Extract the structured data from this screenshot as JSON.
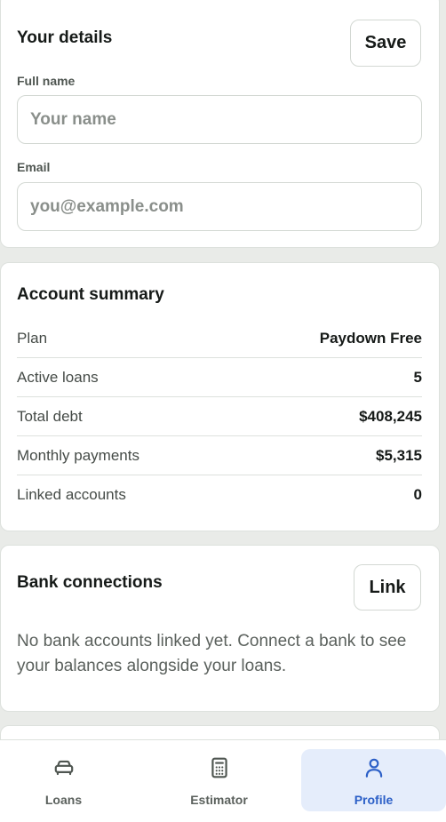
{
  "details": {
    "title": "Your details",
    "save_label": "Save",
    "full_name_label": "Full name",
    "full_name_placeholder": "Your name",
    "full_name_value": "",
    "email_label": "Email",
    "email_placeholder": "you@example.com",
    "email_value": ""
  },
  "summary": {
    "title": "Account summary",
    "rows": [
      {
        "label": "Plan",
        "value": "Paydown Free"
      },
      {
        "label": "Active loans",
        "value": "5"
      },
      {
        "label": "Total debt",
        "value": "$408,245"
      },
      {
        "label": "Monthly payments",
        "value": "$5,315"
      },
      {
        "label": "Linked accounts",
        "value": "0"
      }
    ]
  },
  "bank": {
    "title": "Bank connections",
    "link_label": "Link",
    "empty_text": "No bank accounts linked yet. Connect a bank to see your balances alongside your loans."
  },
  "nav": {
    "items": [
      {
        "label": "Loans",
        "icon": "car-icon"
      },
      {
        "label": "Estimator",
        "icon": "calculator-icon"
      },
      {
        "label": "Profile",
        "icon": "user-icon",
        "active": true
      }
    ]
  },
  "colors": {
    "background": "#e9ebe8",
    "card": "#ffffff",
    "accent": "#2b5fc7",
    "accent_bg": "#e5edfb",
    "text": "#161a18",
    "muted": "#5b615d"
  }
}
